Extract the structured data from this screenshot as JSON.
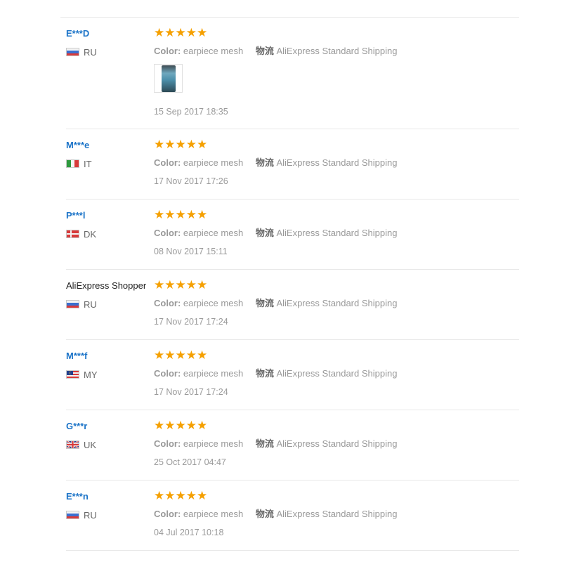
{
  "reviews": [
    {
      "user": "E***D",
      "country": "RU",
      "flag": "ru",
      "stars": "★★★★★",
      "color_label": "Color:",
      "color_value": "earpiece mesh",
      "shipping_label": "物流",
      "shipping_value": "AliExpress Standard Shipping",
      "has_photo": true,
      "date": "15 Sep 2017 18:35"
    },
    {
      "user": "M***e",
      "country": "IT",
      "flag": "it",
      "stars": "★★★★★",
      "color_label": "Color:",
      "color_value": "earpiece mesh",
      "shipping_label": "物流",
      "shipping_value": "AliExpress Standard Shipping",
      "has_photo": false,
      "date": "17 Nov 2017 17:26"
    },
    {
      "user": "P***l",
      "country": "DK",
      "flag": "dk",
      "stars": "★★★★★",
      "color_label": "Color:",
      "color_value": "earpiece mesh",
      "shipping_label": "物流",
      "shipping_value": "AliExpress Standard Shipping",
      "has_photo": false,
      "date": "08 Nov 2017 15:11"
    },
    {
      "user": "AliExpress Shopper",
      "country": "RU",
      "flag": "ru",
      "stars": "★★★★★",
      "color_label": "Color:",
      "color_value": "earpiece mesh",
      "shipping_label": "物流",
      "shipping_value": "AliExpress Standard Shipping",
      "has_photo": false,
      "date": "17 Nov 2017 17:24"
    },
    {
      "user": "M***f",
      "country": "MY",
      "flag": "my",
      "stars": "★★★★★",
      "color_label": "Color:",
      "color_value": "earpiece mesh",
      "shipping_label": "物流",
      "shipping_value": "AliExpress Standard Shipping",
      "has_photo": false,
      "date": "17 Nov 2017 17:24"
    },
    {
      "user": "G***r",
      "country": "UK",
      "flag": "uk",
      "stars": "★★★★★",
      "color_label": "Color:",
      "color_value": "earpiece mesh",
      "shipping_label": "物流",
      "shipping_value": "AliExpress Standard Shipping",
      "has_photo": false,
      "date": "25 Oct 2017 04:47"
    },
    {
      "user": "E***n",
      "country": "RU",
      "flag": "ru",
      "stars": "★★★★★",
      "color_label": "Color:",
      "color_value": "earpiece mesh",
      "shipping_label": "物流",
      "shipping_value": "AliExpress Standard Shipping",
      "has_photo": false,
      "date": "04 Jul 2017 10:18"
    }
  ],
  "colors": {
    "link": "#1c74c8",
    "star": "#f5a000",
    "muted": "#999999",
    "divider": "#e8e8e8"
  }
}
